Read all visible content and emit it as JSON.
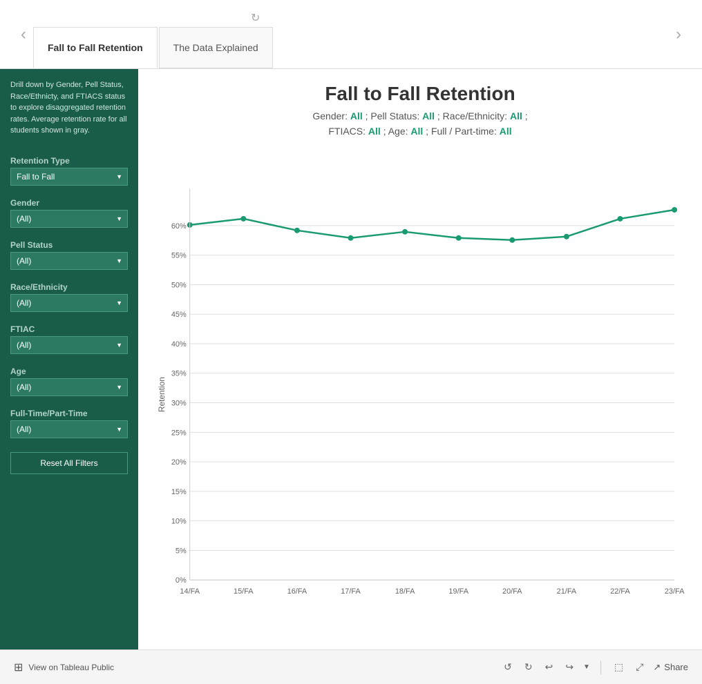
{
  "nav": {
    "prev_arrow": "‹",
    "next_arrow": "›",
    "tabs": [
      {
        "id": "tab-fall-retention",
        "label": "Fall to Fall Retention",
        "active": true
      },
      {
        "id": "tab-data-explained",
        "label": "The Data Explained",
        "active": false
      }
    ],
    "refresh_icon": "↻"
  },
  "sidebar": {
    "description": "Drill down by Gender, Pell Status, Race/Ethnicty, and FTIACS status to explore disaggregated retention rates. Average retention rate for all students shown in gray.",
    "filters": [
      {
        "id": "retention-type",
        "label": "Retention Type",
        "options": [
          "Fall to Fall"
        ],
        "selected": "Fall to Fall"
      },
      {
        "id": "gender",
        "label": "Gender",
        "options": [
          "(All)"
        ],
        "selected": "(All)"
      },
      {
        "id": "pell-status",
        "label": "Pell Status",
        "options": [
          "(All)"
        ],
        "selected": "(All)"
      },
      {
        "id": "race-ethnicity",
        "label": "Race/Ethnicity",
        "options": [
          "(All)"
        ],
        "selected": "(All)"
      },
      {
        "id": "ftiac",
        "label": "FTIAC",
        "options": [
          "(All)"
        ],
        "selected": "(All)"
      },
      {
        "id": "age",
        "label": "Age",
        "options": [
          "(All)"
        ],
        "selected": "(All)"
      },
      {
        "id": "full-part-time",
        "label": "Full-Time/Part-Time",
        "options": [
          "(All)"
        ],
        "selected": "(All)"
      }
    ],
    "reset_button_label": "Reset All Filters"
  },
  "chart": {
    "title": "Fall to Fall Retention",
    "subtitle_parts": [
      {
        "text": "Gender: ",
        "plain": true
      },
      {
        "text": "All",
        "highlight": true
      },
      {
        "text": " ; Pell Status: ",
        "plain": true
      },
      {
        "text": "All",
        "highlight": true
      },
      {
        "text": ";  Race/Ethnicity: ",
        "plain": true
      },
      {
        "text": "All",
        "highlight": true
      },
      {
        "text": ";",
        "plain": true
      }
    ],
    "subtitle_line2": [
      {
        "text": "FTIACS: ",
        "plain": true
      },
      {
        "text": "All",
        "highlight": true
      },
      {
        "text": "; Age: ",
        "plain": true
      },
      {
        "text": "All",
        "highlight": true
      },
      {
        "text": "; Full / Part-time: ",
        "plain": true
      },
      {
        "text": "All",
        "highlight": true
      }
    ],
    "y_axis": {
      "label": "Retention",
      "ticks": [
        "0%",
        "5%",
        "10%",
        "15%",
        "20%",
        "25%",
        "30%",
        "35%",
        "40%",
        "45%",
        "50%",
        "55%",
        "60%"
      ]
    },
    "x_axis": {
      "ticks": [
        "14/FA",
        "15/FA",
        "16/FA",
        "17/FA",
        "18/FA",
        "19/FA",
        "20/FA",
        "21/FA",
        "22/FA",
        "23/FA"
      ]
    },
    "data_points": [
      {
        "x": "14/FA",
        "y": 0.589
      },
      {
        "x": "15/FA",
        "y": 0.6
      },
      {
        "x": "16/FA",
        "y": 0.581
      },
      {
        "x": "17/FA",
        "y": 0.568
      },
      {
        "x": "18/FA",
        "y": 0.578
      },
      {
        "x": "19/FA",
        "y": 0.568
      },
      {
        "x": "20/FA",
        "y": 0.565
      },
      {
        "x": "21/FA",
        "y": 0.57
      },
      {
        "x": "22/FA",
        "y": 0.6
      },
      {
        "x": "23/FA",
        "y": 0.615
      }
    ],
    "line_color": "#1a9a72"
  },
  "bottom_toolbar": {
    "tableau_label": "View on Tableau Public",
    "icons": [
      "↺",
      "↻",
      "↩",
      "↪"
    ],
    "share_label": "Share"
  }
}
